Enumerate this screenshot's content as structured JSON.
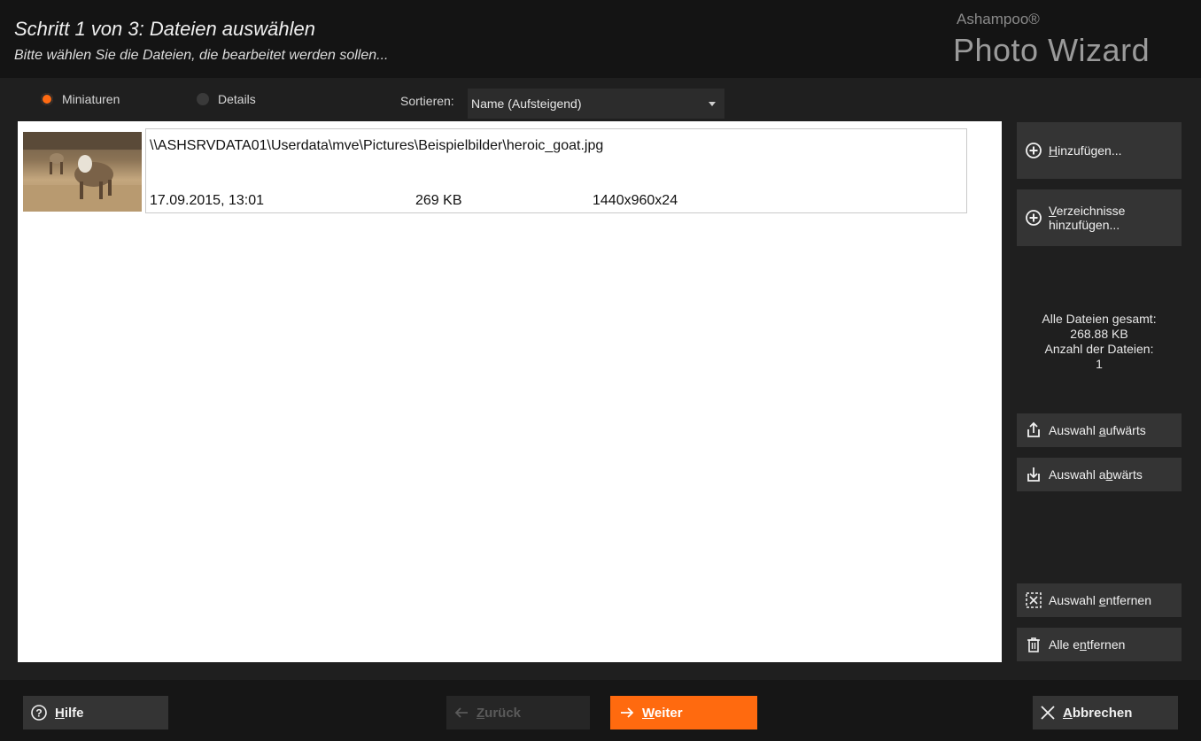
{
  "header": {
    "title": "Schritt 1 von 3: Dateien auswählen",
    "subtitle": "Bitte wählen Sie die Dateien, die bearbeitet werden sollen...",
    "brand_small": "Ashampoo®",
    "brand_big": "Photo Wizard"
  },
  "view": {
    "options": [
      "Miniaturen",
      "Details"
    ],
    "selected": "Miniaturen"
  },
  "sort": {
    "label": "Sortieren:",
    "value": "Name (Aufsteigend)"
  },
  "files": [
    {
      "path": "\\\\ASHSRVDATA01\\Userdata\\mve\\Pictures\\Beispielbilder\\heroic_goat.jpg",
      "date": "17.09.2015, 13:01",
      "size": "269 KB",
      "dimensions": "1440x960x24"
    }
  ],
  "sidebar": {
    "add_prefix": "",
    "add_ul": "H",
    "add_rest": "inzufügen...",
    "add_dirs_ul": "V",
    "add_dirs_line1": "erzeichnisse",
    "add_dirs_line2": "hinzufügen...",
    "stats_total_label": "Alle Dateien gesamt:",
    "stats_total_value": "268.88 KB",
    "stats_count_label": "Anzahl der Dateien:",
    "stats_count_value": "1",
    "up_pre": "Auswahl ",
    "up_ul": "a",
    "up_post": "ufwärts",
    "down_pre": "Auswahl a",
    "down_ul": "b",
    "down_post": "wärts",
    "remove_pre": "Auswahl ",
    "remove_ul": "e",
    "remove_post": "ntfernen",
    "remove_all_pre": "Alle e",
    "remove_all_ul": "n",
    "remove_all_post": "tfernen"
  },
  "footer": {
    "help_ul": "H",
    "help_rest": "ilfe",
    "back_ul": "Z",
    "back_rest": "urück",
    "next_ul": "W",
    "next_rest": "eiter",
    "cancel_ul": "A",
    "cancel_rest": "bbrechen"
  },
  "colors": {
    "accent": "#ff6a0f",
    "background": "#1f1f1f",
    "header": "#141414",
    "button": "#343434"
  },
  "icons": [
    "add-circle-icon",
    "add-folder-circle-icon",
    "move-up-icon",
    "move-down-icon",
    "remove-selection-icon",
    "trash-icon",
    "help-circle-icon",
    "arrow-left-icon",
    "arrow-right-icon",
    "close-icon",
    "dropdown-caret-icon"
  ]
}
